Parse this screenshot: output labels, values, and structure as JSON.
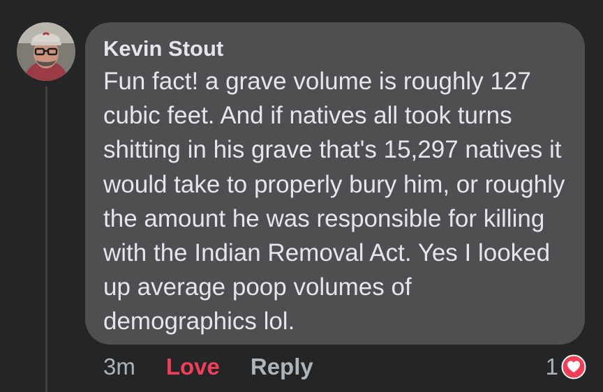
{
  "comment": {
    "author": "Kevin Stout",
    "text": "Fun fact! a grave volume is roughly 127 cubic feet. And if natives all took turns shitting in his grave that's 15,297 natives it would take to properly bury him, or roughly the amount he was responsible for killing with the Indian Removal Act. Yes I looked up average poop volumes of demographics lol.",
    "avatar_icon": "profile-photo"
  },
  "actions": {
    "timestamp": "3m",
    "love_label": "Love",
    "reply_label": "Reply"
  },
  "reactions": {
    "count": "1",
    "icon": "love-reaction-icon"
  },
  "colors": {
    "background": "#242526",
    "bubble": "#4e4f50",
    "text": "#e4e6eb",
    "secondary_text": "#b0b3b8",
    "love": "#f33e58"
  }
}
